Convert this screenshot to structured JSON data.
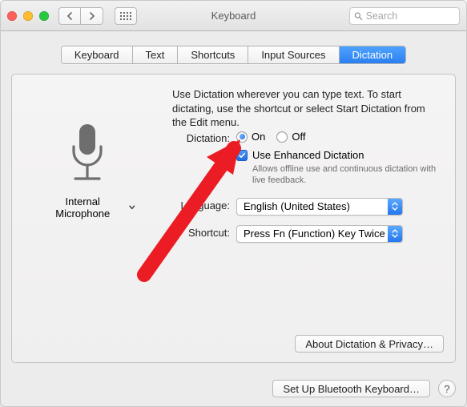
{
  "title": "Keyboard",
  "search": {
    "placeholder": "Search"
  },
  "tabs": {
    "keyboard": "Keyboard",
    "text": "Text",
    "shortcuts": "Shortcuts",
    "input_sources": "Input Sources",
    "dictation": "Dictation"
  },
  "intro": "Use Dictation wherever you can type text. To start dictating, use the shortcut or select Start Dictation from the Edit menu.",
  "mic": {
    "label": "Internal Microphone"
  },
  "dictation": {
    "label": "Dictation:",
    "on": "On",
    "off": "Off",
    "enhanced_label": "Use Enhanced Dictation",
    "enhanced_desc": "Allows offline use and continuous dictation with live feedback."
  },
  "language": {
    "label": "Language:",
    "value": "English (United States)"
  },
  "shortcut": {
    "label": "Shortcut:",
    "value": "Press Fn (Function) Key Twice"
  },
  "buttons": {
    "about": "About Dictation & Privacy…",
    "setup_bt": "Set Up Bluetooth Keyboard…",
    "help": "?"
  }
}
